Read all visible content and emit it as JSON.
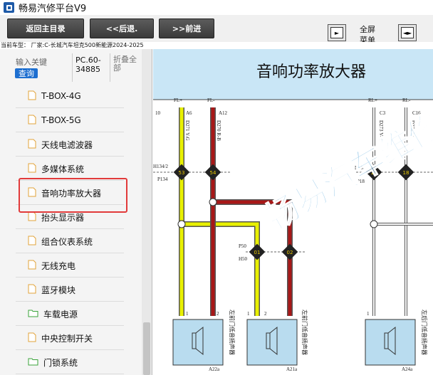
{
  "app": {
    "title": "畅易汽修平台V9"
  },
  "toolbar": {
    "home_label": "返回主目录",
    "back_label": "<<后退.",
    "forward_label": ">>前进",
    "fullscreen_line1": "全屏",
    "fullscreen_line2": "菜单"
  },
  "car_info": "当前车型： 厂家:C-长城汽车坦克500新能源2024-2025",
  "sidebar": {
    "search_placeholder": "输入关键",
    "search_button": "查询",
    "code_line1": "PC.60-",
    "code_line2": "34885",
    "collapse_line1": "折叠全",
    "collapse_line2": "部",
    "items": [
      {
        "label": "T-BOX-4G",
        "icon": "file-icon"
      },
      {
        "label": "T-BOX-5G",
        "icon": "file-icon"
      },
      {
        "label": "天线电滤波器",
        "icon": "file-icon"
      },
      {
        "label": "多媒体系统",
        "icon": "file-icon"
      },
      {
        "label": "音响功率放大器",
        "icon": "file-icon"
      },
      {
        "label": "抬头显示器",
        "icon": "file-icon"
      },
      {
        "label": "组合仪表系统",
        "icon": "file-icon"
      },
      {
        "label": "无线充电",
        "icon": "file-icon"
      },
      {
        "label": "蓝牙模块",
        "icon": "file-icon"
      },
      {
        "label": "车载电源",
        "icon": "folder-icon"
      },
      {
        "label": "中央控制开关",
        "icon": "file-icon"
      },
      {
        "label": "门锁系统",
        "icon": "folder-icon"
      }
    ]
  },
  "diagram": {
    "title": "音响功率放大器",
    "watermark": "畅易汽车维修",
    "labels": {
      "fl_plus": "FL+",
      "fl_minus": "FL-",
      "rl_plus": "RL+",
      "rl_minus": "RL-",
      "pin_10": "10",
      "pin_a6": "A6",
      "pin_a12": "A12",
      "pin_c3": "C3",
      "pin_c16": "C16",
      "wire_yg": "D271 Y-G",
      "wire_rb": "D270 R-B",
      "wire_vb": "D273 V-B",
      "wire_w": "D274 W",
      "h134": "H134/2",
      "p134": "P134",
      "h18": "H18",
      "p18": "P18",
      "p50": "P50",
      "h50": "H50",
      "conn_53": "53",
      "conn_54": "54",
      "conn_11": "11",
      "conn_18": "18",
      "conn_01": "01",
      "conn_02": "02",
      "spk_pin1": "1",
      "spk_pin2": "2",
      "spk1_name": "左前门低音扬声器",
      "spk2_name": "左前门低音扬声器",
      "spk3_name": "左后门低音扬声器",
      "a22a": "A22a",
      "a21a": "A21a",
      "a24a": "A24a"
    },
    "colors": {
      "yellow_wire": "#e8f000",
      "red_wire": "#a81818",
      "header_bg": "#c9e6f6",
      "watermark": "#4aa0d8"
    }
  }
}
